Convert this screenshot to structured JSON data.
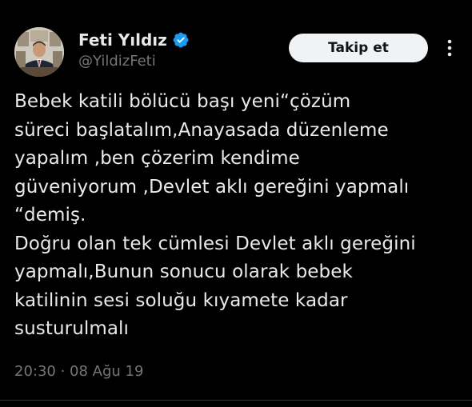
{
  "colors": {
    "background": "#000000",
    "text_primary": "#e7e9ea",
    "text_secondary": "#71767b",
    "verified_badge": "#1d9bf0",
    "follow_button_bg": "#eff3f4",
    "follow_button_text": "#0f1419",
    "divider": "#2f3336"
  },
  "author": {
    "display_name": "Feti Yıldız",
    "handle": "@YildizFeti",
    "verified_icon": "verified-badge-icon",
    "avatar_icon": "profile-photo"
  },
  "actions": {
    "follow_label": "Takip et",
    "more_icon": "more-options-icon"
  },
  "tweet": {
    "lines": [
      "Bebek katili bölücü başı yeni“çözüm",
      "süreci başlatalım,Anayasada düzenleme",
      "yapalım ,ben çözerim kendime",
      "güveniyorum ,Devlet aklı gereğini yapmalı",
      "“demiş.",
      "Doğru olan tek cümlesi Devlet aklı gereğini",
      "yapmalı,Bunun sonucu olarak bebek",
      "katilinin sesi soluğu kıyamete kadar",
      "susturulmalı"
    ]
  },
  "meta": {
    "timestamp": "20:30 · 08 Ağu 19"
  }
}
